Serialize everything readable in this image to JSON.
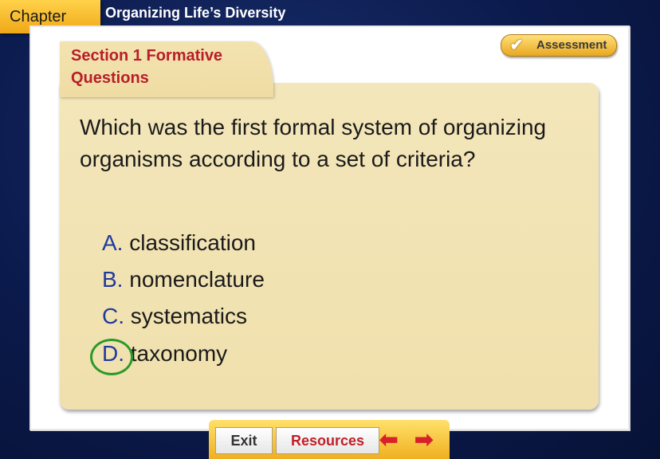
{
  "header": {
    "chapter_label": "Chapter",
    "title": "Organizing Life’s Diversity"
  },
  "section": {
    "label": "Section 1 Formative Questions"
  },
  "assessment": {
    "label": "Assessment",
    "icon": "check-icon"
  },
  "quiz": {
    "question": "Which was the first formal system of organizing organisms according to a set of criteria?",
    "options": [
      {
        "letter": "A.",
        "text": "classification"
      },
      {
        "letter": "B.",
        "text": "nomenclature"
      },
      {
        "letter": "C.",
        "text": "systematics"
      },
      {
        "letter": "D.",
        "text": "taxonomy"
      }
    ],
    "correct_index": 3
  },
  "toolbar": {
    "exit_label": "Exit",
    "resources_label": "Resources",
    "prev_icon": "arrow-left-icon",
    "next_icon": "arrow-right-icon"
  },
  "colors": {
    "accent_gold": "#f0b020",
    "title_red": "#b81e2a",
    "letter_blue": "#1f3a9e",
    "correct_green": "#2a9a2a"
  }
}
